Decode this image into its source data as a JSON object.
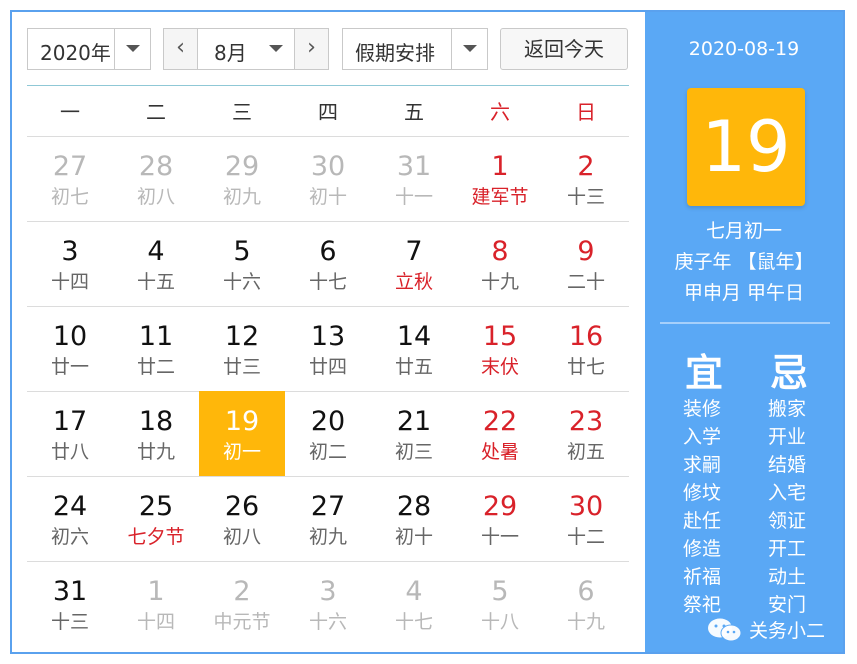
{
  "toolbar": {
    "year": "2020年",
    "month": "8月",
    "prev_glyph": "‹",
    "next_glyph": "›",
    "holiday": "假期安排",
    "today": "返回今天"
  },
  "weekdays": [
    "一",
    "二",
    "三",
    "四",
    "五",
    "六",
    "日"
  ],
  "days": [
    {
      "d": "27",
      "l": "初七",
      "other": true
    },
    {
      "d": "28",
      "l": "初八",
      "other": true
    },
    {
      "d": "29",
      "l": "初九",
      "other": true
    },
    {
      "d": "30",
      "l": "初十",
      "other": true
    },
    {
      "d": "31",
      "l": "十一",
      "other": true
    },
    {
      "d": "1",
      "l": "建军节",
      "fest": true
    },
    {
      "d": "2",
      "l": "十三"
    },
    {
      "d": "3",
      "l": "十四"
    },
    {
      "d": "4",
      "l": "十五"
    },
    {
      "d": "5",
      "l": "十六"
    },
    {
      "d": "6",
      "l": "十七"
    },
    {
      "d": "7",
      "l": "立秋",
      "fest": true
    },
    {
      "d": "8",
      "l": "十九"
    },
    {
      "d": "9",
      "l": "二十"
    },
    {
      "d": "10",
      "l": "廿一"
    },
    {
      "d": "11",
      "l": "廿二"
    },
    {
      "d": "12",
      "l": "廿三"
    },
    {
      "d": "13",
      "l": "廿四"
    },
    {
      "d": "14",
      "l": "廿五"
    },
    {
      "d": "15",
      "l": "末伏",
      "fest": true
    },
    {
      "d": "16",
      "l": "廿七"
    },
    {
      "d": "17",
      "l": "廿八"
    },
    {
      "d": "18",
      "l": "廿九"
    },
    {
      "d": "19",
      "l": "初一",
      "today": true
    },
    {
      "d": "20",
      "l": "初二"
    },
    {
      "d": "21",
      "l": "初三"
    },
    {
      "d": "22",
      "l": "处暑",
      "fest": true
    },
    {
      "d": "23",
      "l": "初五"
    },
    {
      "d": "24",
      "l": "初六"
    },
    {
      "d": "25",
      "l": "七夕节",
      "fest": true
    },
    {
      "d": "26",
      "l": "初八"
    },
    {
      "d": "27",
      "l": "初九"
    },
    {
      "d": "28",
      "l": "初十"
    },
    {
      "d": "29",
      "l": "十一"
    },
    {
      "d": "30",
      "l": "十二"
    },
    {
      "d": "31",
      "l": "十三"
    },
    {
      "d": "1",
      "l": "十四",
      "other": true
    },
    {
      "d": "2",
      "l": "中元节",
      "other": true
    },
    {
      "d": "3",
      "l": "十六",
      "other": true
    },
    {
      "d": "4",
      "l": "十七",
      "other": true
    },
    {
      "d": "5",
      "l": "十八",
      "other": true
    },
    {
      "d": "6",
      "l": "十九",
      "other": true
    }
  ],
  "panel": {
    "date": "2020-08-19",
    "day": "19",
    "lunar": "七月初一",
    "year_line": "庚子年 【鼠年】",
    "ganzhi": "甲申月 甲午日",
    "yi_title": "宜",
    "ji_title": "忌",
    "yi": [
      "装修",
      "入学",
      "求嗣",
      "修坟",
      "赴任",
      "修造",
      "祈福",
      "祭祀"
    ],
    "ji": [
      "搬家",
      "开业",
      "结婚",
      "入宅",
      "领证",
      "开工",
      "动土",
      "安门"
    ],
    "watermark": "关务小二"
  },
  "colors": {
    "accent": "#5aa8f5",
    "today": "#ffb70a",
    "holiday_red": "#d9222a"
  }
}
